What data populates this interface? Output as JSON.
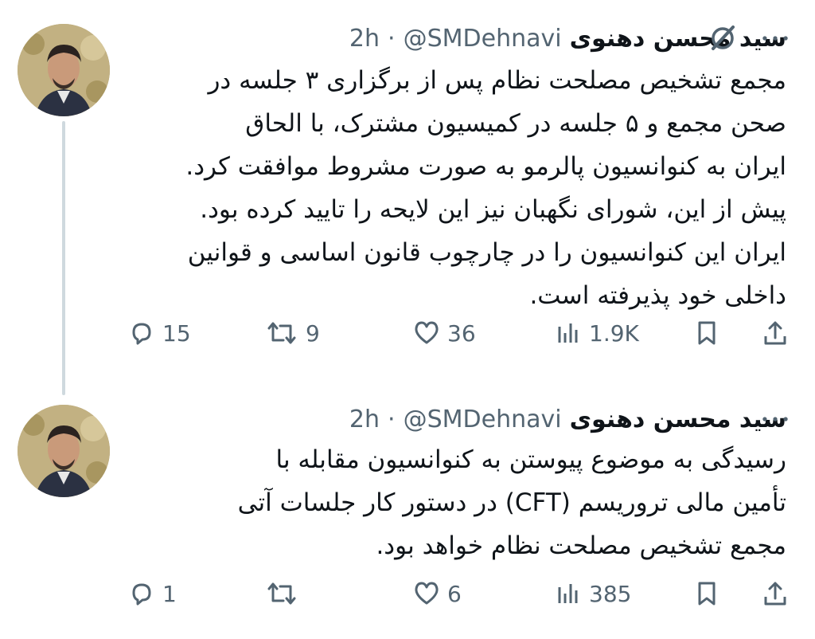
{
  "tweets": [
    {
      "author_name": "سید محسن دهنوی",
      "handle": "@SMDehnavi",
      "separator": "·",
      "time": "2h",
      "text": "مجمع تشخیص مصلحت نظام پس از برگزاری ۳ جلسه در\nصحن مجمع و ۵ جلسه در کمیسیون مشترک، با الحاق\nایران به کنوانسیون پالرمو به صورت مشروط موافقت کرد.\nپیش از این، شورای نگهبان نیز این لایحه را تایید کرده بود.\nایران این کنوانسیون را در چارچوب قانون اساسی و قوانین\nداخلی خود پذیرفته است.",
      "replies": "15",
      "retweets": "9",
      "likes": "36",
      "views": "1.9K"
    },
    {
      "author_name": "سید محسن دهنوی",
      "handle": "@SMDehnavi",
      "separator": "·",
      "time": "2h",
      "text": "رسیدگی به موضوع پیوستن به کنوانسیون مقابله با\nتأمین مالی تروریسم (CFT) در دستور کار جلسات آتی\nمجمع تشخیص مصلحت نظام خواهد بود.",
      "replies": "1",
      "retweets": "",
      "likes": "6",
      "views": "385"
    }
  ],
  "icons": {
    "more": "more-icon",
    "grok": "grok-icon",
    "reply": "reply-icon",
    "retweet": "retweet-icon",
    "like": "heart-icon",
    "views": "views-icon",
    "bookmark": "bookmark-icon",
    "share": "share-icon"
  },
  "colors": {
    "text": "#0f1419",
    "secondary": "#536471",
    "thread_line": "#cfd9de"
  }
}
